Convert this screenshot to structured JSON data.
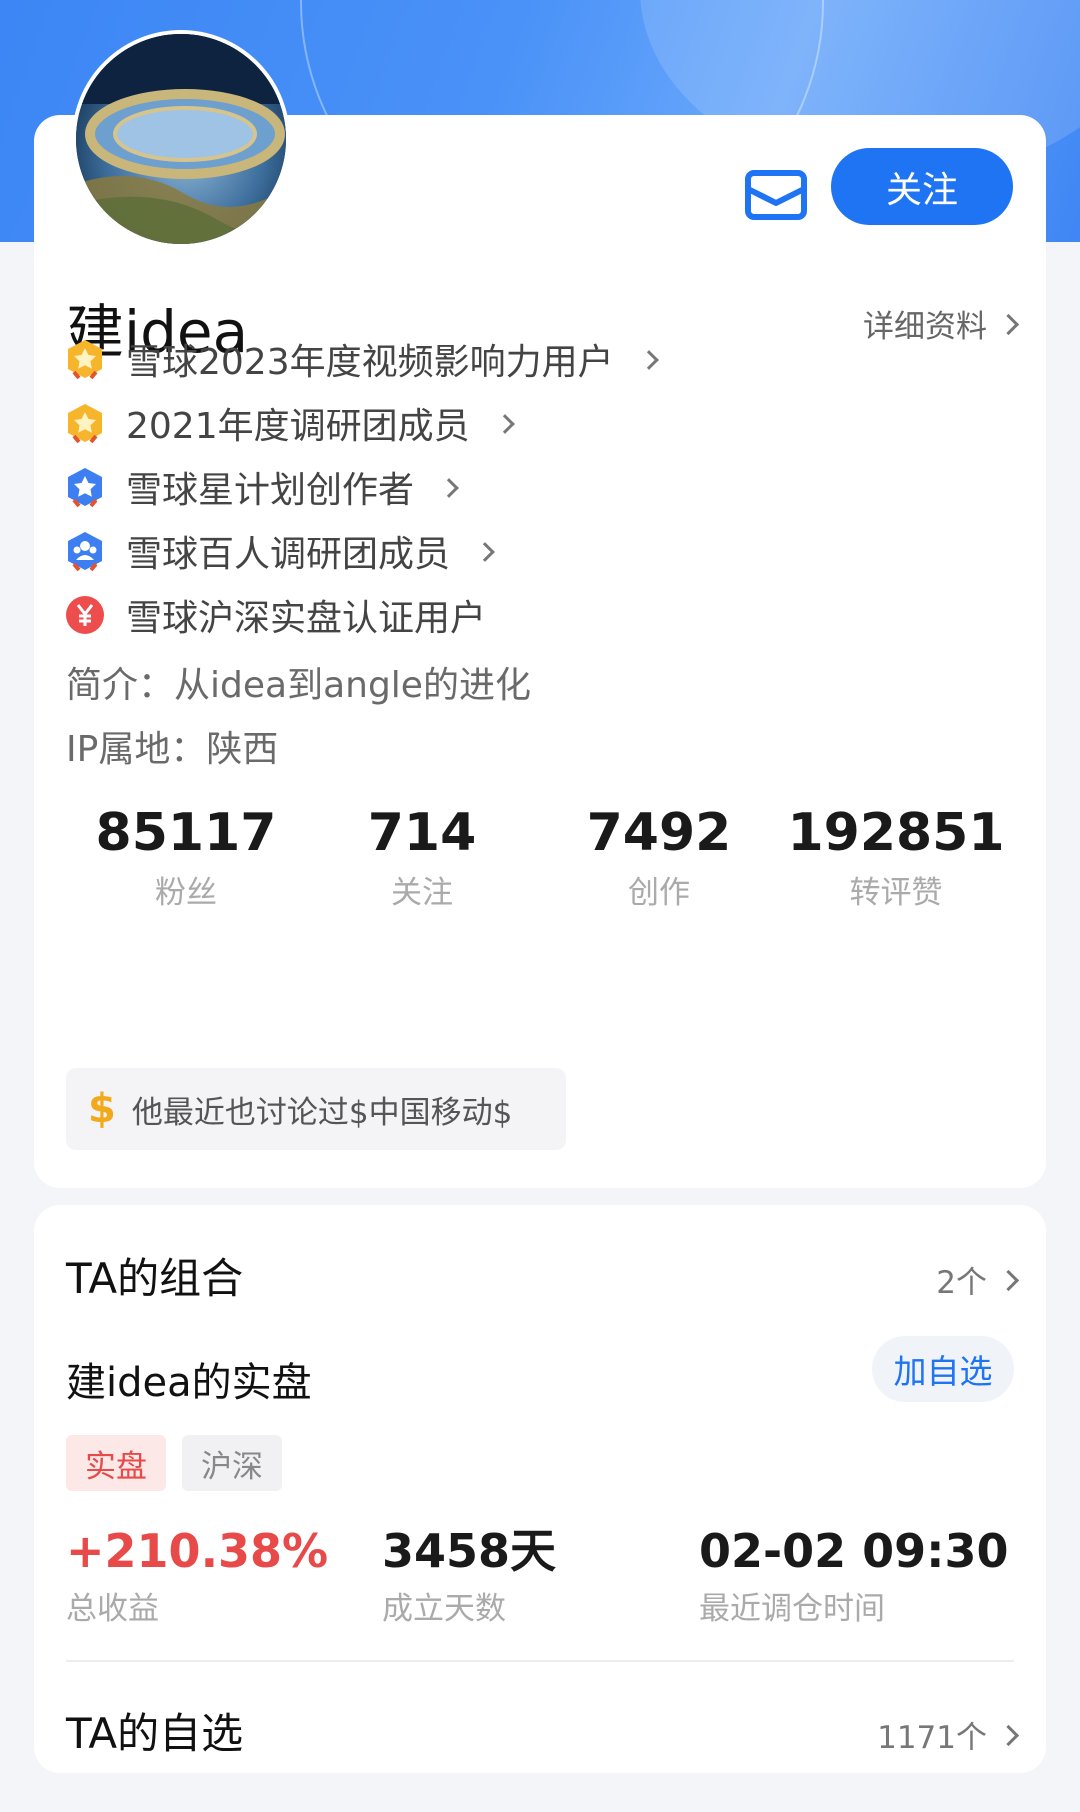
{
  "header": {
    "follow_label": "关注",
    "icons": {
      "mail": "mail-icon"
    },
    "accent_color": "#1e74f2"
  },
  "profile": {
    "name": "建idea",
    "detail_link": "详细资料",
    "badges": [
      {
        "label": "雪球2023年度视频影响力用户",
        "icon": "gold-star-badge-icon",
        "has_arrow": true
      },
      {
        "label": "2021年度调研团成员",
        "icon": "gold-star-badge-icon",
        "has_arrow": true
      },
      {
        "label": "雪球星计划创作者",
        "icon": "blue-star-badge-icon",
        "has_arrow": true
      },
      {
        "label": "雪球百人调研团成员",
        "icon": "blue-people-badge-icon",
        "has_arrow": true
      },
      {
        "label": "雪球沪深实盘认证用户",
        "icon": "red-yen-badge-icon",
        "has_arrow": false
      }
    ],
    "bio": "简介：从idea到angle的进化",
    "ip": "IP属地：陕西",
    "stats": [
      {
        "value": "85117",
        "label": "粉丝"
      },
      {
        "value": "714",
        "label": "关注"
      },
      {
        "value": "7492",
        "label": "创作"
      },
      {
        "value": "192851",
        "label": "转评赞"
      }
    ],
    "discussion": "他最近也讨论过$中国移动$"
  },
  "portfolio": {
    "section_title": "TA的组合",
    "count": "2个",
    "name": "建idea的实盘",
    "add_label": "加自选",
    "tags": [
      "实盘",
      "沪深"
    ],
    "total_return": "+210.38%",
    "total_return_label": "总收益",
    "days": "3458天",
    "days_label": "成立天数",
    "last_rebalance": "02-02 09:30",
    "last_rebalance_label": "最近调仓时间"
  },
  "watchlist": {
    "section_title": "TA的自选",
    "count": "1171个"
  }
}
